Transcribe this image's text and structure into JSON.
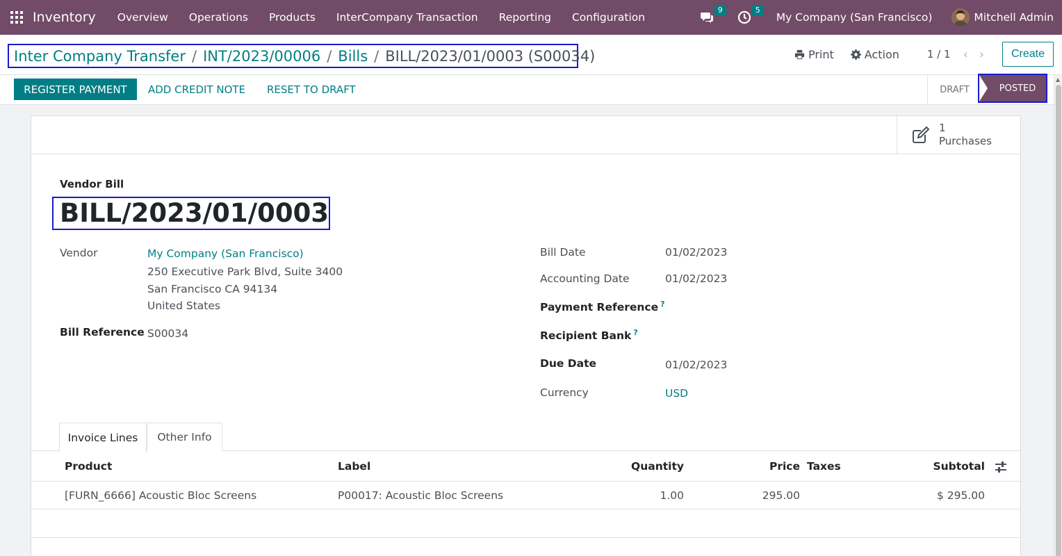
{
  "navbar": {
    "app_name": "Inventory",
    "menu": [
      "Overview",
      "Operations",
      "Products",
      "InterCompany Transaction",
      "Reporting",
      "Configuration"
    ],
    "messages_count": "9",
    "activities_count": "5",
    "company": "My Company (San Francisco)",
    "user": "Mitchell Admin"
  },
  "breadcrumb": {
    "items": [
      "Inter Company Transfer",
      "INT/2023/00006",
      "Bills"
    ],
    "separator": "/",
    "current": "BILL/2023/01/0003 (S00034)"
  },
  "control_panel": {
    "print_label": "Print",
    "action_label": "Action",
    "pager": "1 / 1",
    "prev_icon": "‹",
    "next_icon": "›",
    "create_label": "Create"
  },
  "status_bar": {
    "buttons": [
      "REGISTER PAYMENT",
      "ADD CREDIT NOTE",
      "RESET TO DRAFT"
    ],
    "stages": [
      "DRAFT",
      "POSTED"
    ],
    "active_stage": "POSTED"
  },
  "smart_button": {
    "count": "1",
    "label": "Purchases"
  },
  "form": {
    "doc_type": "Vendor Bill",
    "doc_name": "BILL/2023/01/0003",
    "vendor_label": "Vendor",
    "vendor_name": "My Company (San Francisco)",
    "vendor_address_1": "250 Executive Park Blvd, Suite 3400",
    "vendor_address_2": "San Francisco CA 94134",
    "vendor_address_3": "United States",
    "bill_ref_label": "Bill Reference",
    "bill_ref_value": "S00034",
    "bill_date_label": "Bill Date",
    "bill_date_value": "01/02/2023",
    "accounting_date_label": "Accounting Date",
    "accounting_date_value": "01/02/2023",
    "payment_ref_label": "Payment Reference",
    "recipient_bank_label": "Recipient Bank",
    "help_mark": "?",
    "due_date_label": "Due Date",
    "due_date_value": "01/02/2023",
    "currency_label": "Currency",
    "currency_value": "USD"
  },
  "tabs": [
    "Invoice Lines",
    "Other Info"
  ],
  "table": {
    "columns": [
      "Product",
      "Label",
      "Quantity",
      "Price",
      "Taxes",
      "Subtotal"
    ],
    "rows": [
      {
        "product": "[FURN_6666] Acoustic Bloc Screens",
        "label": "P00017: Acoustic Bloc Screens",
        "quantity": "1.00",
        "price": "295.00",
        "taxes": "",
        "subtotal": "$ 295.00"
      }
    ]
  },
  "colors": {
    "brand": "#714b67",
    "accent": "#017e84",
    "highlight_box": "#1a1acc"
  }
}
